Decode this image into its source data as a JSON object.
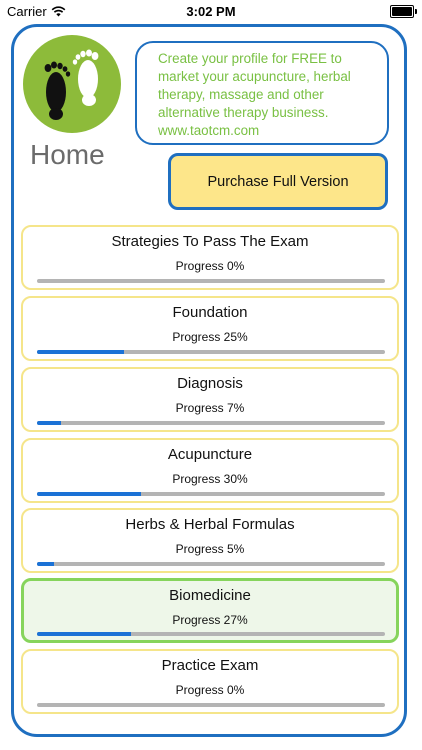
{
  "status_bar": {
    "carrier": "Carrier",
    "time": "3:02 PM"
  },
  "header": {
    "logo_icon": "footprints-logo-icon",
    "title": "Home",
    "promo_text": "Create your profile for FREE to market your acupuncture, herbal therapy, massage and other alternative therapy business. www.taotcm.com",
    "purchase_label": "Purchase Full Version"
  },
  "colors": {
    "frame_border": "#1f6fc0",
    "promo_text": "#79c043",
    "purchase_bg": "#fde68a",
    "card_border": "#f5e58a",
    "active_card_border": "#86d45c",
    "progress_fill": "#1b72d6",
    "progress_track": "#b4b4b4"
  },
  "modules": [
    {
      "name": "Strategies To Pass The Exam",
      "progress_label": "Progress 0%",
      "progress": 0
    },
    {
      "name": "Foundation",
      "progress_label": "Progress 25%",
      "progress": 25
    },
    {
      "name": "Diagnosis",
      "progress_label": "Progress 7%",
      "progress": 7
    },
    {
      "name": "Acupuncture",
      "progress_label": "Progress 30%",
      "progress": 30
    },
    {
      "name": "Herbs & Herbal Formulas",
      "progress_label": "Progress 5%",
      "progress": 5
    },
    {
      "name": "Biomedicine",
      "progress_label": "Progress 27%",
      "progress": 27,
      "selected": true
    },
    {
      "name": "Practice Exam",
      "progress_label": "Progress 0%",
      "progress": 0
    }
  ]
}
